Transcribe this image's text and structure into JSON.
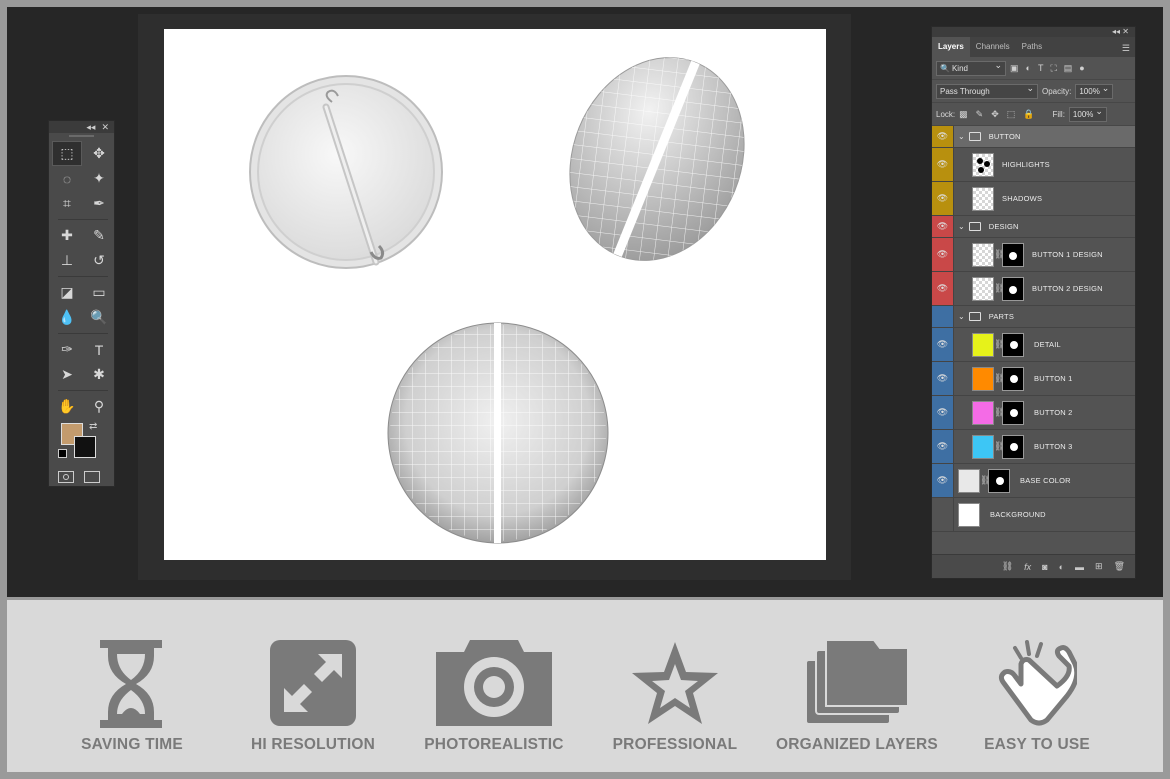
{
  "app": {
    "name": "Photoshop mockup"
  },
  "toolbox": {
    "header_collapse": "◂◂",
    "header_close": "✕",
    "tools": [
      {
        "icon": "rectangular-marquee-icon"
      },
      {
        "icon": "move-icon"
      },
      {
        "icon": "lasso-icon"
      },
      {
        "icon": "magic-wand-icon"
      },
      {
        "icon": "crop-icon"
      },
      {
        "icon": "eyedropper-icon"
      },
      {
        "icon": "healing-brush-icon"
      },
      {
        "icon": "brush-icon"
      },
      {
        "icon": "clone-stamp-icon"
      },
      {
        "icon": "history-brush-icon"
      },
      {
        "icon": "eraser-icon"
      },
      {
        "icon": "gradient-icon"
      },
      {
        "icon": "blur-icon"
      },
      {
        "icon": "dodge-icon"
      },
      {
        "icon": "pen-icon"
      },
      {
        "icon": "type-icon"
      },
      {
        "icon": "path-selection-icon"
      },
      {
        "icon": "custom-shape-icon"
      },
      {
        "icon": "hand-icon"
      },
      {
        "icon": "zoom-icon"
      }
    ],
    "foreground_color": "#c39b6d",
    "background_color": "#111111"
  },
  "layers_panel": {
    "top_controls": "◂◂  ✕",
    "tabs": [
      {
        "label": "Layers",
        "active": true
      },
      {
        "label": "Channels",
        "active": false
      },
      {
        "label": "Paths",
        "active": false
      }
    ],
    "filter_kind": "Kind",
    "blend_mode": "Pass Through",
    "opacity_label": "Opacity:",
    "opacity_value": "100%",
    "lock_label": "Lock:",
    "fill_label": "Fill:",
    "fill_value": "100%",
    "layers": [
      {
        "name": "BUTTON",
        "type": "group",
        "color": "#b8900e",
        "visible": true
      },
      {
        "name": "HIGHLIGHTS",
        "type": "layer",
        "color": "#b8900e",
        "visible": true
      },
      {
        "name": "SHADOWS",
        "type": "layer",
        "color": "#b8900e",
        "visible": true
      },
      {
        "name": "DESIGN",
        "type": "group",
        "color": "#c94848",
        "visible": true
      },
      {
        "name": "BUTTON 1 DESIGN",
        "type": "smart",
        "color": "#c94848",
        "visible": true
      },
      {
        "name": "BUTTON 2 DESIGN",
        "type": "smart",
        "color": "#c94848",
        "visible": true
      },
      {
        "name": "PARTS",
        "type": "group",
        "color": "#3e6fa3",
        "visible": false
      },
      {
        "name": "DETAIL",
        "type": "fill",
        "color": "#3e6fa3",
        "swatch": "#e6f21a",
        "visible": true
      },
      {
        "name": "BUTTON 1",
        "type": "fill",
        "color": "#3e6fa3",
        "swatch": "#ff8a00",
        "visible": true
      },
      {
        "name": "BUTTON 2",
        "type": "fill",
        "color": "#3e6fa3",
        "swatch": "#f46be6",
        "visible": true
      },
      {
        "name": "BUTTON 3",
        "type": "fill",
        "color": "#3e6fa3",
        "swatch": "#3dc6f5",
        "visible": true
      },
      {
        "name": "BASE COLOR",
        "type": "fill",
        "color": "#3e6fa3",
        "swatch": "#e8e8e8",
        "visible": true
      },
      {
        "name": "BACKGROUND",
        "type": "plain",
        "color": "none",
        "swatch": "#ffffff",
        "visible": false
      }
    ]
  },
  "features": [
    {
      "label": "SAVING TIME",
      "icon": "hourglass-icon"
    },
    {
      "label": "HI RESOLUTION",
      "icon": "expand-arrows-icon"
    },
    {
      "label": "PHOTOREALISTIC",
      "icon": "camera-icon"
    },
    {
      "label": "PROFESSIONAL",
      "icon": "star-icon"
    },
    {
      "label": "ORGANIZED LAYERS",
      "icon": "folders-icon"
    },
    {
      "label": "EASY TO USE",
      "icon": "tap-hand-icon"
    }
  ]
}
